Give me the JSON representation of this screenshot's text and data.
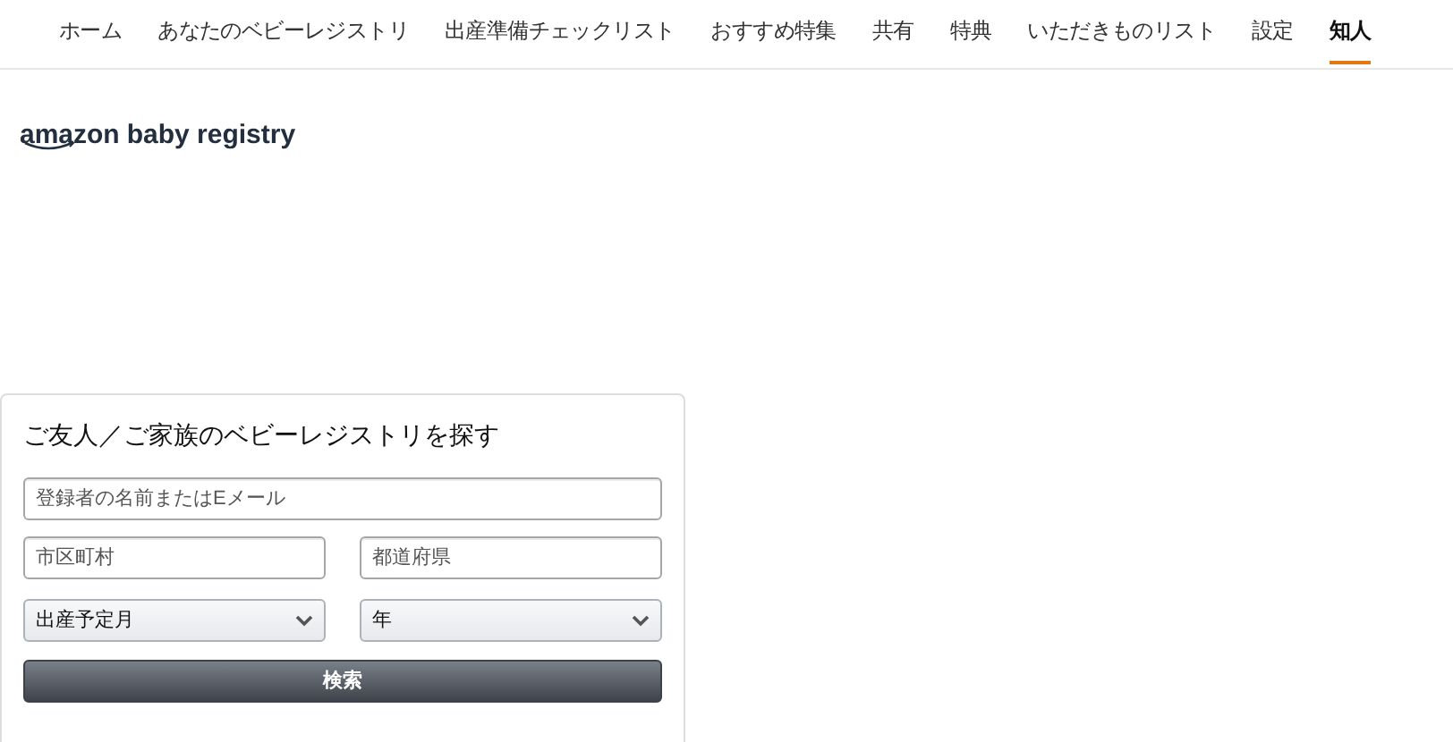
{
  "nav": [
    {
      "label": "ホーム",
      "selected": false
    },
    {
      "label": "あなたのベビーレジストリ",
      "selected": false
    },
    {
      "label": "出産準備チェックリスト",
      "selected": false
    },
    {
      "label": "おすすめ特集",
      "selected": false
    },
    {
      "label": "共有",
      "selected": false
    },
    {
      "label": "特典",
      "selected": false
    },
    {
      "label": "いただきものリスト",
      "selected": false
    },
    {
      "label": "設定",
      "selected": false
    },
    {
      "label": "知人",
      "selected": true
    }
  ],
  "logo": {
    "brand": "amazon",
    "text": "baby registry"
  },
  "search": {
    "title": "ご友人／ご家族のベビーレジストリを探す",
    "name_field": {
      "placeholder": "登録者の名前またはEメール"
    },
    "city_field": {
      "placeholder": "市区町村"
    },
    "prefecture_field": {
      "placeholder": "都道府県"
    },
    "month_select": {
      "value": "出産予定月"
    },
    "year_select": {
      "value": "年"
    },
    "button": "検索"
  }
}
